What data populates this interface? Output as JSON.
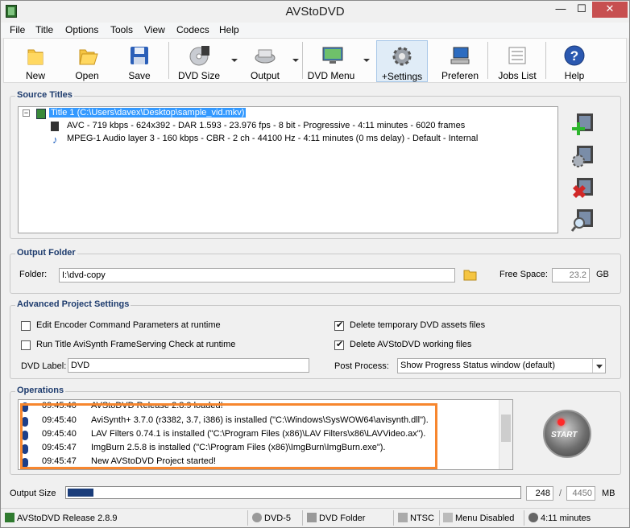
{
  "window": {
    "title": "AVStoDVD",
    "minimize": "—",
    "maximize": "☐",
    "close": "✕"
  },
  "menu": [
    "File",
    "Title",
    "Options",
    "Tools",
    "View",
    "Codecs",
    "Help"
  ],
  "toolbar": {
    "new": "New",
    "open": "Open",
    "save": "Save",
    "dvd_size": "DVD Size",
    "output": "Output",
    "dvd_menu": "DVD Menu",
    "settings": "+Settings",
    "preferences": "Preferen",
    "jobs_list": "Jobs List",
    "help": "Help"
  },
  "source_titles": {
    "legend": "Source Titles",
    "expander": "−",
    "title1": "Title 1 (C:\\Users\\davex\\Desktop\\sample_vid.mkv)",
    "video": "AVC - 719 kbps - 624x392 - DAR 1.593 - 23.976 fps - 8 bit - Progressive - 4:11 minutes - 6020 frames",
    "audio": "MPEG-1 Audio layer 3 - 160 kbps - CBR - 2 ch - 44100 Hz - 4:11 minutes (0 ms delay) - Default - Internal"
  },
  "output_folder": {
    "legend": "Output Folder",
    "folder_label": "Folder:",
    "folder_value": "I:\\dvd-copy",
    "free_space_label": "Free Space:",
    "free_space_value": "23.2",
    "free_space_unit": "GB"
  },
  "advanced": {
    "legend": "Advanced Project Settings",
    "edit_encoder": "Edit Encoder Command Parameters at runtime",
    "run_avisynth": "Run Title AviSynth FrameServing Check at runtime",
    "delete_temp": "Delete temporary DVD assets files",
    "delete_working": "Delete AVStoDVD working files",
    "dvd_label_label": "DVD Label:",
    "dvd_label_value": "DVD",
    "post_process_label": "Post Process:",
    "post_process_value": "Show Progress Status window (default)",
    "checked": {
      "edit_encoder": false,
      "run_avisynth": false,
      "delete_temp": true,
      "delete_working": true
    }
  },
  "operations": {
    "legend": "Operations",
    "logs": [
      {
        "time": "09:45:40",
        "msg": "AVStoDVD Release 2.8.9 loaded!"
      },
      {
        "time": "09:45:40",
        "msg": "AviSynth+ 3.7.0 (r3382, 3.7, i386) is installed (\"C:\\Windows\\SysWOW64\\avisynth.dll\")."
      },
      {
        "time": "09:45:40",
        "msg": "LAV Filters 0.74.1 is installed (\"C:\\Program Files (x86)\\LAV Filters\\x86\\LAVVideo.ax\")."
      },
      {
        "time": "09:45:47",
        "msg": "ImgBurn 2.5.8 is installed (\"C:\\Program Files (x86)\\ImgBurn\\ImgBurn.exe\")."
      },
      {
        "time": "09:45:47",
        "msg": "New AVStoDVD Project started!"
      }
    ],
    "start": "START"
  },
  "output_size": {
    "label": "Output Size",
    "current": "248",
    "slash": "/",
    "max": "4450",
    "unit": "MB",
    "fill_fraction": 0.056
  },
  "statusbar": {
    "release": "AVStoDVD Release 2.8.9",
    "dvd_type": "DVD-5",
    "dvd_folder": "DVD Folder",
    "standard": "NTSC",
    "menu": "Menu Disabled",
    "duration": "4:11 minutes"
  },
  "colors": {
    "selection": "#3399ff",
    "highlight_box": "#f7862e",
    "progress": "#1b3d7a",
    "close_button": "#c74f50"
  }
}
